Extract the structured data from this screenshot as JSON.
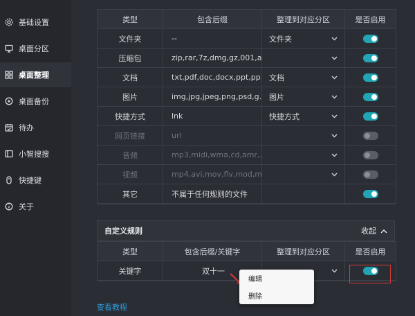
{
  "sidebar": {
    "items": [
      {
        "label": "基础设置",
        "icon": "gear-icon"
      },
      {
        "label": "桌面分区",
        "icon": "monitor-icon"
      },
      {
        "label": "桌面整理",
        "icon": "grid-icon",
        "active": true
      },
      {
        "label": "桌面备份",
        "icon": "backup-icon"
      },
      {
        "label": "待办",
        "icon": "calendar-icon"
      },
      {
        "label": "小智搜搜",
        "icon": "search-window-icon"
      },
      {
        "label": "快捷键",
        "icon": "mouse-icon"
      },
      {
        "label": "关于",
        "icon": "info-icon"
      }
    ]
  },
  "rules_table": {
    "headers": [
      "类型",
      "包含后缀",
      "整理到对应分区",
      "是否启用"
    ],
    "rows": [
      {
        "type": "文件夹",
        "suffix": "--",
        "partition": "文件夹",
        "enabled": true,
        "dim": false
      },
      {
        "type": "压缩包",
        "suffix": "zip,rar,7z,dmg,gz,001,a...",
        "partition": "",
        "enabled": true,
        "dim": false
      },
      {
        "type": "文档",
        "suffix": "txt,pdf,doc,docx,ppt,pp...",
        "partition": "文档",
        "enabled": true,
        "dim": false
      },
      {
        "type": "图片",
        "suffix": "img,jpg,jpeg,png,psd,g...",
        "partition": "图片",
        "enabled": true,
        "dim": false
      },
      {
        "type": "快捷方式",
        "suffix": "lnk",
        "partition": "快捷方式",
        "enabled": true,
        "dim": false
      },
      {
        "type": "网页链接",
        "suffix": "url",
        "partition": "",
        "enabled": false,
        "dim": true
      },
      {
        "type": "音频",
        "suffix": "mp3,midi,wma,cd,amr,...",
        "partition": "",
        "enabled": false,
        "dim": true
      },
      {
        "type": "视频",
        "suffix": "mp4,avi,mov,flv,mod,m...",
        "partition": "",
        "enabled": false,
        "dim": true
      },
      {
        "type": "其它",
        "suffix": "不属于任何规则的文件",
        "partition": "",
        "enabled": true,
        "dim": false,
        "no_select": true
      }
    ]
  },
  "custom_rules": {
    "title": "自定义规则",
    "collapse_label": "收起",
    "headers": [
      "类型",
      "包含后缀/关键字",
      "整理到对应分区",
      "是否启用"
    ],
    "rows": [
      {
        "type": "关键字",
        "keyword": "双十一",
        "partition": "",
        "enabled": true
      }
    ]
  },
  "context_menu": {
    "items": [
      "编辑",
      "删除"
    ]
  },
  "tutorial_link": "查看教程",
  "colors": {
    "accent": "#21a5b5",
    "highlight_border": "#d63a3a",
    "link": "#2d9cdb"
  }
}
